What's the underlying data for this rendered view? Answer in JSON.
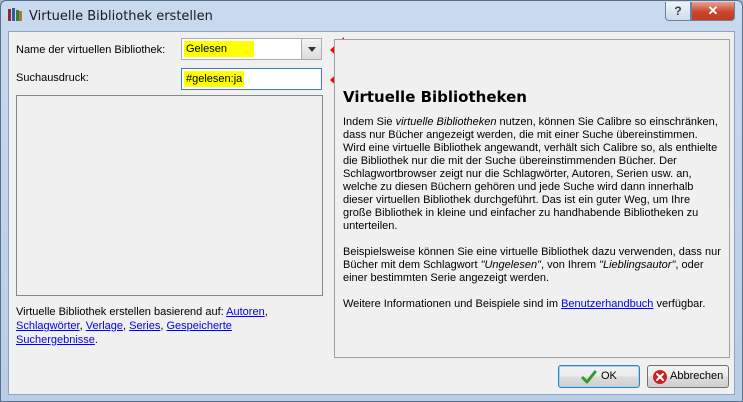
{
  "window": {
    "title": "Virtuelle Bibliothek erstellen",
    "help_label": "?",
    "close_label": "✕"
  },
  "form": {
    "name_label": "Name der virtuellen Bibliothek:",
    "name_value": "Gelesen",
    "search_label": "Suchausdruck:",
    "search_value": "#gelesen:ja"
  },
  "footer": {
    "prefix": "Virtuelle Bibliothek erstellen basierend auf:",
    "links": [
      "Autoren",
      "Schlagwörter",
      "Verlage",
      "Series",
      "Gespeicherte Suchergebnisse"
    ]
  },
  "help": {
    "heading": "Virtuelle Bibliotheken",
    "p1_a": "Indem Sie ",
    "p1_em": "virtuelle Bibliotheken",
    "p1_b": " nutzen, können Sie Calibre so einschränken, dass nur Bücher angezeigt werden, die mit einer Suche übereinstimmen. Wird eine virtuelle Bibliothek angewandt, verhält sich Calibre so, als enthielte die Bibliothek nur die mit der Suche übereinstimmenden Bücher. Der Schlagwortbrowser zeigt nur die Schlagwörter, Autoren, Serien usw. an, welche zu diesen Büchern gehören und jede Suche wird dann innerhalb dieser virtuellen Bibliothek durchgeführt. Das ist ein guter Weg, um Ihre große Bibliothek in kleine und einfacher zu handhabende Bibliotheken zu unterteilen.",
    "p2_a": "Beispielsweise können Sie eine virtuelle Bibliothek dazu verwenden, dass nur Bücher mit dem Schlagwort ",
    "p2_em1": "\"Ungelesen\"",
    "p2_b": ", von Ihrem ",
    "p2_em2": "\"Lieblingsautor\"",
    "p2_c": ", oder einer bestimmten Serie angezeigt werden.",
    "p3_a": "Weitere Informationen und Beispiele sind im ",
    "p3_link": "Benutzerhandbuch",
    "p3_b": " verfügbar."
  },
  "buttons": {
    "ok_label": "OK",
    "cancel_label": "Abbrechen"
  },
  "colors": {
    "highlight": "#ffff00",
    "arrow": "#ff0000",
    "link": "#0000ee"
  }
}
